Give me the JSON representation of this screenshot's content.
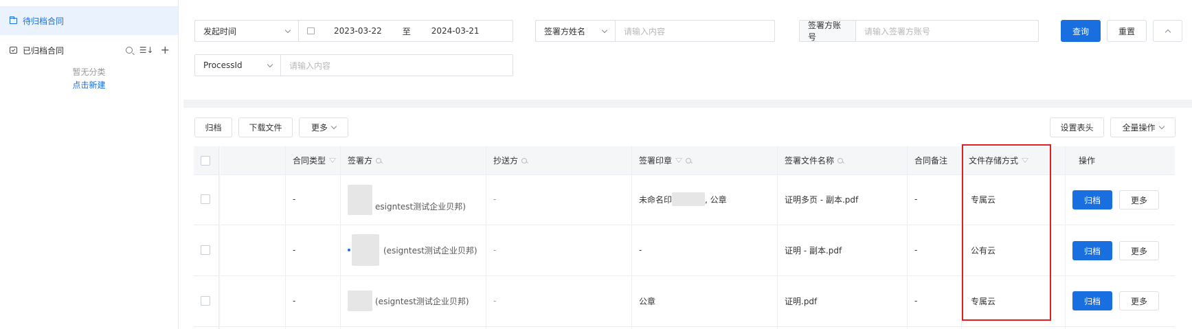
{
  "sidebar": {
    "active_item": "待归档合同",
    "archived_item": "已归档合同",
    "empty_text": "暂无分类",
    "create_link": "点击新建"
  },
  "filters": {
    "date_type": "发起时间",
    "date_start": "2023-03-22",
    "date_sep": "至",
    "date_end": "2024-03-21",
    "signer_name_select": "签署方姓名",
    "signer_name_placeholder": "请输入内容",
    "signer_account_label": "签署方账号",
    "signer_account_placeholder": "请输入签署方账号",
    "process_select": "ProcessId",
    "process_placeholder": "请输入内容",
    "query_button": "查询",
    "reset_button": "重置"
  },
  "toolbar": {
    "archive": "归档",
    "download": "下载文件",
    "more": "更多",
    "set_header": "设置表头",
    "bulk": "全量操作"
  },
  "table": {
    "headers": {
      "contract_type": "合同类型",
      "signer": "签署方",
      "cc": "抄送方",
      "seal": "签署印章",
      "file_name": "签署文件名称",
      "remark": "合同备注",
      "storage": "文件存储方式",
      "action": "操作"
    },
    "rows": [
      {
        "contract_type": "-",
        "signer": "esigntest测试企业贝邦)",
        "cc": "-",
        "seal_a": "未命名印",
        "seal_b": ", 公章",
        "file_name": "证明多页 - 副本.pdf",
        "remark": "-",
        "storage": "专属云",
        "btn_archive": "归档",
        "btn_more": "更多"
      },
      {
        "contract_type": "-",
        "signer": "(esigntest测试企业贝邦)",
        "cc": "-",
        "seal_a": "-",
        "seal_b": "",
        "file_name": "证明 - 副本.pdf",
        "remark": "-",
        "storage": "公有云",
        "btn_archive": "归档",
        "btn_more": "更多"
      },
      {
        "contract_type": "-",
        "signer": "(esigntest测试企业贝邦)",
        "cc": "-",
        "seal_a": "公章",
        "seal_b": "",
        "file_name": "证明.pdf",
        "remark": "-",
        "storage": "专属云",
        "btn_archive": "归档",
        "btn_more": "更多"
      }
    ]
  },
  "colors": {
    "primary": "#1a6fe0",
    "highlight_box": "#e02020",
    "header_bg": "#f5f6f8"
  }
}
